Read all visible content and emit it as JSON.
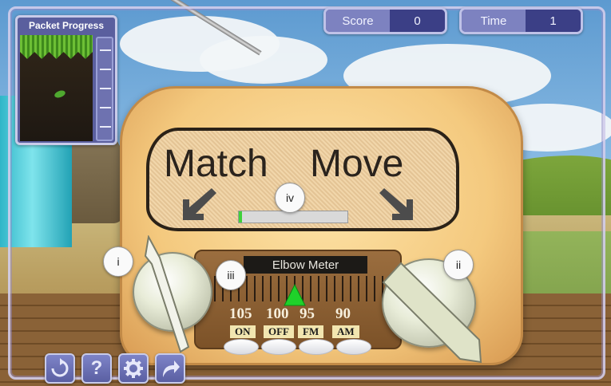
{
  "hud": {
    "score_label": "Score",
    "score_value": "0",
    "time_label": "Time",
    "time_value": "1"
  },
  "packet_progress": {
    "title": "Packet Progress"
  },
  "radio": {
    "left_word": "Match",
    "right_word": "Move",
    "progress": 0.03,
    "meter_label": "Elbow Meter",
    "frequencies": [
      "105",
      "100",
      "95",
      "90"
    ],
    "bands": [
      "ON",
      "OFF",
      "FM",
      "AM"
    ]
  },
  "callouts": {
    "i": "i",
    "ii": "ii",
    "iii": "iii",
    "iv": "iv"
  },
  "toolbar": {
    "buttons": [
      "restart-icon",
      "help-icon",
      "settings-icon",
      "forward-icon"
    ],
    "help_glyph": "?"
  },
  "colors": {
    "hud_bg": "#4a4f96",
    "progress_fill": "#3fd13a",
    "needle": "#1fd12a",
    "radio_body": "#f4c97e"
  }
}
